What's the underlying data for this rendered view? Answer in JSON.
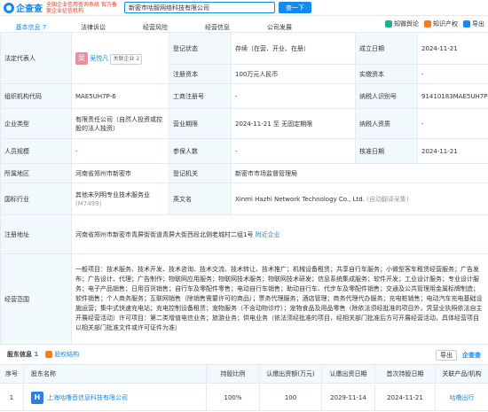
{
  "header": {
    "logo_text": "企查查",
    "subtitle": "全国企业信用查询系统 官方备案企业征信机构",
    "search_value": "新密市咕智网络科技有限公司",
    "search_button": "查一下"
  },
  "tabs": [
    {
      "label": "基本信息 7"
    },
    {
      "label": "法律诉讼"
    },
    {
      "label": "经营风险"
    },
    {
      "label": "经营信息"
    },
    {
      "label": "公司发展"
    }
  ],
  "rightbar": {
    "zhi": "知微舆论",
    "brand": "知识产权",
    "export": "导出"
  },
  "info": {
    "legal_rep_label": "法定代表人",
    "legal_rep_avatar": "吴",
    "legal_rep_name": "吴悦凡",
    "legal_rep_related": "关联企业 2",
    "reg_status_label": "登记状态",
    "reg_status": "存续（在营、开业、在册）",
    "found_date_label": "成立日期",
    "found_date": "2024-11-21",
    "reg_capital_label": "注册资本",
    "reg_capital": "100万元人民币",
    "paid_capital_label": "实缴资本",
    "paid_capital": "-",
    "org_code_label": "组织机构代码",
    "org_code": "MAE5UH7P-6",
    "biz_reg_no_label": "工商注册号",
    "biz_reg_no": "-",
    "taxpayer_no_label": "纳税人识别号",
    "taxpayer_no": "91410183MAE5UH7P6K",
    "company_type_label": "企业类型",
    "company_type": "有限责任公司（自然人投资或控股的法人独资）",
    "biz_term_label": "营业期限",
    "biz_term": "2024-11-21 至 无固定期限",
    "taxpayer_qual_label": "纳税人资质",
    "taxpayer_qual": "-",
    "staff_label": "人员规模",
    "staff": "-",
    "insured_label": "参保人数",
    "insured": "-",
    "approve_date_label": "核准日期",
    "approve_date": "2024-11-21",
    "region_label": "所属地区",
    "region": "河南省郑州市新密市",
    "reg_authority_label": "登记机关",
    "reg_authority": "新密市市场监督管理局",
    "industry_label": "国标行业",
    "industry": "其他未列明专业技术服务业",
    "industry_code": "(M7499)",
    "en_name_label": "英文名",
    "en_name": "Xinmi Hazhi Network Technology Co., Ltd.",
    "en_name_note": "(自动翻译采集)",
    "address_label": "注册地址",
    "address": "河南省郑州市新密市青屏街街道青屏大街西段北侧老城村二组1号",
    "address_nearby": "附近企业",
    "scope_label": "经营范围",
    "scope": "一般项目：技术服务、技术开发、技术咨询、技术交流、技术转让、技术推广；机械设备租赁；共享自行车服务；小微型客车租赁经营服务；广告发布；广告设计、代理；广告制作；物联网应用服务；物联网技术服务；物联网技术研发；信息系统集成服务；软件开发；工业设计服务；专业设计服务；电子产品销售；日用百货销售；自行车及零配件零售；电动自行车销售；助动自行车、代步车及零配件销售；交通及公共管理用金属标牌制造；软件销售；个人商务服务；互联网销售（除销售需要许可的商品）；票务代理服务；酒店管理；商务代理代办服务；充电桩销售；电动汽车充电基础设施运营；集中式快速充电站；充电控制设备租赁；宠物服务（不含动物诊疗）；宠物食品及用品零售（除依法须经批准的项目外，凭营业执照依法自主开展经营活动）许可项目：第二类增值电信业务；旅游业务；供电业务（依法须经批准的项目，经相关部门批准后方可开展经营活动，具体经营项目以相关部门批准文件或许可证件为准）"
  },
  "shareholders": {
    "title": "股东信息",
    "count": "1",
    "struct_label": "股权结构",
    "export_label": "导出",
    "brand": "企查查",
    "headers": [
      "序号",
      "股东名称",
      "持股比例",
      "认缴出资额(万元)",
      "认缴出资日期",
      "首次持股日期",
      "关联产品/机构"
    ],
    "rows": [
      {
        "index": "1",
        "name": "上海咕噜音信息科技有限公司",
        "icon_text": "H",
        "ratio": "100%",
        "amount": "100",
        "date": "2029-11-14",
        "first_date": "2024-11-21",
        "product": "咕噜出行"
      }
    ]
  }
}
